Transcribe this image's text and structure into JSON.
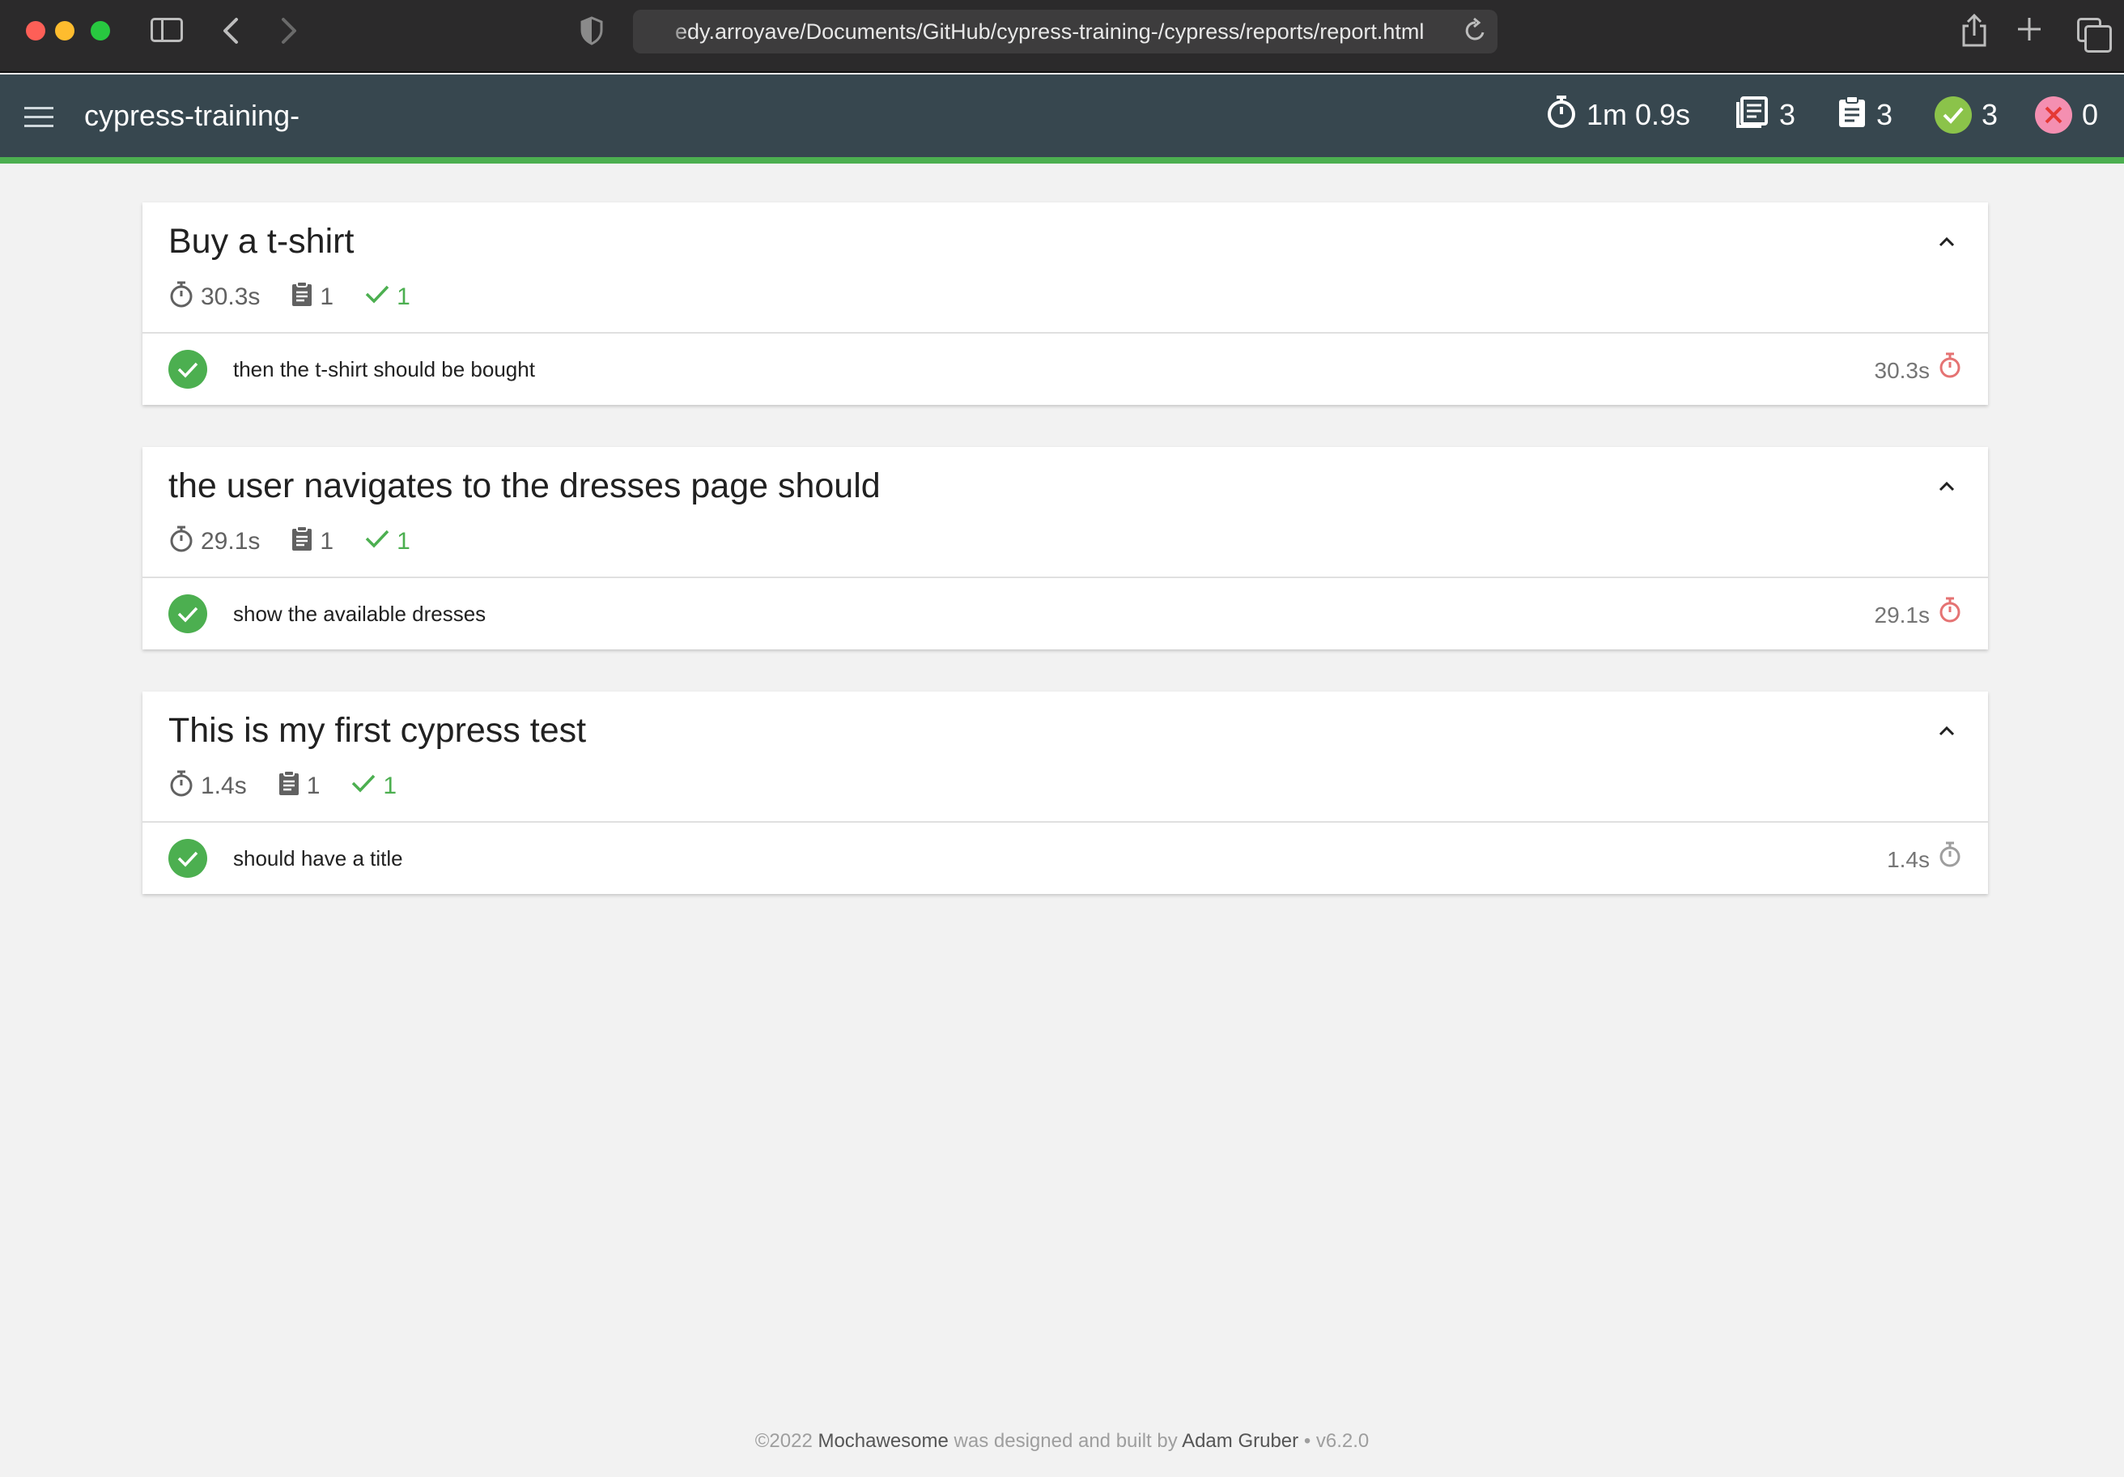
{
  "browser": {
    "url": "edy.arroyave/Documents/GitHub/cypress-training-/cypress/reports/report.html"
  },
  "navbar": {
    "title": "cypress-training-",
    "stats": {
      "duration": "1m 0.9s",
      "suites": "3",
      "tests": "3",
      "passes": "3",
      "failures": "0"
    }
  },
  "suites": [
    {
      "title": "Buy a t-shirt",
      "duration": "30.3s",
      "tests": "1",
      "passes": "1",
      "test": {
        "title": "then the t-shirt should be bought",
        "duration": "30.3s",
        "speed": "slow"
      }
    },
    {
      "title": "the user navigates to the dresses page should",
      "duration": "29.1s",
      "tests": "1",
      "passes": "1",
      "test": {
        "title": "show the available dresses",
        "duration": "29.1s",
        "speed": "slow"
      }
    },
    {
      "title": "This is my first cypress test",
      "duration": "1.4s",
      "tests": "1",
      "passes": "1",
      "test": {
        "title": "should have a title",
        "duration": "1.4s",
        "speed": "fast"
      }
    }
  ],
  "footer": {
    "copyright": "©2022",
    "brand": "Mochawesome",
    "middle": "was designed and built by",
    "author": "Adam Gruber",
    "version": "• v6.2.0"
  },
  "colors": {
    "navbar": "#37474f",
    "pass": "#4caf50",
    "slow": "#e57373",
    "fast": "#9e9e9e"
  }
}
